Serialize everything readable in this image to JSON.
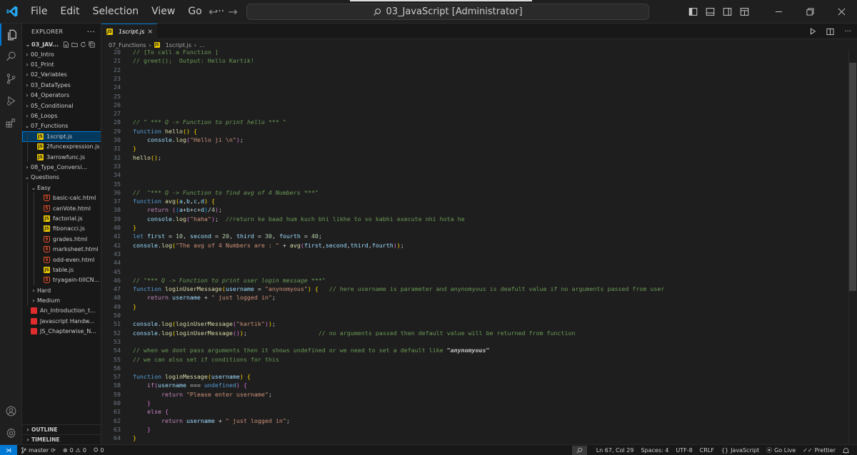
{
  "menu": [
    "File",
    "Edit",
    "Selection",
    "View",
    "Go",
    "···"
  ],
  "search": {
    "title": "03_JavaScript [Administrator]"
  },
  "explorer": {
    "header": "EXPLORER",
    "root": "03_JAV...",
    "items": [
      {
        "label": "00_Intro",
        "kind": "folder",
        "depth": 1,
        "open": false
      },
      {
        "label": "01_Print",
        "kind": "folder",
        "depth": 1,
        "open": false
      },
      {
        "label": "02_Variables",
        "kind": "folder",
        "depth": 1,
        "open": false
      },
      {
        "label": "03_DataTypes",
        "kind": "folder",
        "depth": 1,
        "open": false
      },
      {
        "label": "04_Operators",
        "kind": "folder",
        "depth": 1,
        "open": false
      },
      {
        "label": "05_Conditional",
        "kind": "folder",
        "depth": 1,
        "open": false
      },
      {
        "label": "06_Loops",
        "kind": "folder",
        "depth": 1,
        "open": false
      },
      {
        "label": "07_Functions",
        "kind": "folder",
        "depth": 1,
        "open": true
      },
      {
        "label": "1script.js",
        "kind": "js",
        "depth": 2,
        "selected": true
      },
      {
        "label": "2funcexpression.js",
        "kind": "js",
        "depth": 2
      },
      {
        "label": "3arrowfunc.js",
        "kind": "js",
        "depth": 2
      },
      {
        "label": "08_Type_Conversi...",
        "kind": "folder",
        "depth": 1,
        "open": false
      },
      {
        "label": "Questions",
        "kind": "folder",
        "depth": 1,
        "open": true
      },
      {
        "label": "Easy",
        "kind": "folder",
        "depth": 2,
        "open": true
      },
      {
        "label": "basic-calc.html",
        "kind": "html",
        "depth": 3
      },
      {
        "label": "canVote.html",
        "kind": "html",
        "depth": 3
      },
      {
        "label": "factorial.js",
        "kind": "js",
        "depth": 3
      },
      {
        "label": "fibonacci.js",
        "kind": "js",
        "depth": 3
      },
      {
        "label": "grades.html",
        "kind": "html",
        "depth": 3
      },
      {
        "label": "marksheet.html",
        "kind": "html",
        "depth": 3
      },
      {
        "label": "odd-even.html",
        "kind": "html",
        "depth": 3
      },
      {
        "label": "table.js",
        "kind": "js",
        "depth": 3
      },
      {
        "label": "tryagain-tillCN...",
        "kind": "html",
        "depth": 3
      },
      {
        "label": "Hard",
        "kind": "folder",
        "depth": 2,
        "open": false
      },
      {
        "label": "Medium",
        "kind": "folder",
        "depth": 2,
        "open": false
      },
      {
        "label": "An_Introduction_t...",
        "kind": "pdf",
        "depth": 1
      },
      {
        "label": "Javascript Handw...",
        "kind": "pdf",
        "depth": 1
      },
      {
        "label": "JS_Chapterwise_N...",
        "kind": "pdf",
        "depth": 1
      }
    ],
    "outline": "OUTLINE",
    "timeline": "TIMELINE"
  },
  "tab": {
    "label": "1script.js",
    "close": "×"
  },
  "breadcrumb": {
    "folder": "07_Functions",
    "file": "1script.js",
    "rest": "..."
  },
  "code": [
    {
      "n": "20",
      "t": [
        [
          "cmt",
          "// [To call a Function ]"
        ]
      ]
    },
    {
      "n": "21",
      "t": [
        [
          "cmt",
          "// greet();  Output: Hello Kartik!"
        ]
      ]
    },
    {
      "n": "22",
      "t": []
    },
    {
      "n": "23",
      "t": []
    },
    {
      "n": "24",
      "t": []
    },
    {
      "n": "25",
      "t": []
    },
    {
      "n": "26",
      "t": []
    },
    {
      "n": "27",
      "t": []
    },
    {
      "n": "28",
      "t": [
        [
          "cmti",
          "// \" *** Q -> Function to print hello *** \""
        ]
      ]
    },
    {
      "n": "29",
      "t": [
        [
          "kw",
          "function "
        ],
        [
          "fn",
          "hello"
        ],
        [
          "br1",
          "()"
        ],
        [
          "txt",
          " "
        ],
        [
          "br1",
          "{"
        ]
      ]
    },
    {
      "n": "30",
      "t": [
        [
          "txt",
          "    "
        ],
        [
          "var",
          "console"
        ],
        [
          "txt",
          "."
        ],
        [
          "fn",
          "log"
        ],
        [
          "br2",
          "("
        ],
        [
          "str",
          "\"Hello ji \\n\""
        ],
        [
          "br2",
          ")"
        ],
        [
          "txt",
          ";"
        ]
      ]
    },
    {
      "n": "31",
      "t": [
        [
          "br1",
          "}"
        ]
      ]
    },
    {
      "n": "32",
      "t": [
        [
          "fn",
          "hello"
        ],
        [
          "br1",
          "()"
        ],
        [
          "txt",
          ";"
        ]
      ]
    },
    {
      "n": "33",
      "t": []
    },
    {
      "n": "34",
      "t": []
    },
    {
      "n": "35",
      "t": []
    },
    {
      "n": "36",
      "t": [
        [
          "cmti",
          "//  \"*** Q -> Function to find avg of 4 Numbers ***\""
        ]
      ]
    },
    {
      "n": "37",
      "t": [
        [
          "kw",
          "function "
        ],
        [
          "fn",
          "avg"
        ],
        [
          "br1",
          "("
        ],
        [
          "var",
          "a"
        ],
        [
          "txt",
          ","
        ],
        [
          "var",
          "b"
        ],
        [
          "txt",
          ","
        ],
        [
          "var",
          "c"
        ],
        [
          "txt",
          ","
        ],
        [
          "var",
          "d"
        ],
        [
          "br1",
          ")"
        ],
        [
          "txt",
          " "
        ],
        [
          "br1",
          "{"
        ]
      ]
    },
    {
      "n": "38",
      "t": [
        [
          "txt",
          "    "
        ],
        [
          "ctl",
          "return "
        ],
        [
          "br2",
          "("
        ],
        [
          "br3",
          "("
        ],
        [
          "var",
          "a"
        ],
        [
          "txt",
          "+"
        ],
        [
          "var",
          "b"
        ],
        [
          "txt",
          "+"
        ],
        [
          "var",
          "c"
        ],
        [
          "txt",
          "+"
        ],
        [
          "var",
          "d"
        ],
        [
          "br3",
          ")"
        ],
        [
          "txt",
          "/"
        ],
        [
          "num",
          "4"
        ],
        [
          "br2",
          ")"
        ],
        [
          "txt",
          ";"
        ]
      ]
    },
    {
      "n": "39",
      "t": [
        [
          "txt",
          "    "
        ],
        [
          "var",
          "console"
        ],
        [
          "txt",
          "."
        ],
        [
          "fn",
          "log"
        ],
        [
          "br2",
          "("
        ],
        [
          "str",
          "\"haha\""
        ],
        [
          "br2",
          ")"
        ],
        [
          "txt",
          ";  "
        ],
        [
          "cmt",
          "//return ke baad hum kuch bhi likhe to vo kabhi execute nhi hota he"
        ]
      ]
    },
    {
      "n": "40",
      "t": [
        [
          "br1",
          "}"
        ]
      ]
    },
    {
      "n": "41",
      "t": [
        [
          "kw",
          "let "
        ],
        [
          "var",
          "first"
        ],
        [
          "txt",
          " = "
        ],
        [
          "num",
          "10"
        ],
        [
          "txt",
          ", "
        ],
        [
          "var",
          "second"
        ],
        [
          "txt",
          " = "
        ],
        [
          "num",
          "20"
        ],
        [
          "txt",
          ", "
        ],
        [
          "var",
          "third"
        ],
        [
          "txt",
          " = "
        ],
        [
          "num",
          "30"
        ],
        [
          "txt",
          ", "
        ],
        [
          "var",
          "fourth"
        ],
        [
          "txt",
          " = "
        ],
        [
          "num",
          "40"
        ],
        [
          "txt",
          ";"
        ]
      ]
    },
    {
      "n": "42",
      "t": [
        [
          "var",
          "console"
        ],
        [
          "txt",
          "."
        ],
        [
          "fn",
          "log"
        ],
        [
          "br1",
          "("
        ],
        [
          "str",
          "\"The avg of 4 Numbers are : \""
        ],
        [
          "txt",
          " + "
        ],
        [
          "fn",
          "avg"
        ],
        [
          "br2",
          "("
        ],
        [
          "var",
          "first"
        ],
        [
          "txt",
          ","
        ],
        [
          "var",
          "second"
        ],
        [
          "txt",
          ","
        ],
        [
          "var",
          "third"
        ],
        [
          "txt",
          ","
        ],
        [
          "var",
          "fourth"
        ],
        [
          "br2",
          ")"
        ],
        [
          "br1",
          ")"
        ],
        [
          "txt",
          ";"
        ]
      ]
    },
    {
      "n": "43",
      "t": []
    },
    {
      "n": "44",
      "t": []
    },
    {
      "n": "45",
      "t": []
    },
    {
      "n": "46",
      "t": [
        [
          "cmti",
          "// \"*** Q -> Function to print user login message ***\""
        ]
      ]
    },
    {
      "n": "47",
      "t": [
        [
          "kw",
          "function "
        ],
        [
          "fn",
          "loginUserMessage"
        ],
        [
          "br1",
          "("
        ],
        [
          "var",
          "username"
        ],
        [
          "txt",
          " = "
        ],
        [
          "str",
          "\"anynomyous\""
        ],
        [
          "br1",
          ")"
        ],
        [
          "txt",
          " "
        ],
        [
          "br1",
          "{"
        ],
        [
          "txt",
          "   "
        ],
        [
          "cmt",
          "// here username is parameter and anynomyous is deafult value if no arguments passed from user"
        ]
      ]
    },
    {
      "n": "48",
      "t": [
        [
          "txt",
          "    "
        ],
        [
          "ctl",
          "return "
        ],
        [
          "var",
          "username"
        ],
        [
          "txt",
          " + "
        ],
        [
          "str",
          "\" just logged in\""
        ],
        [
          "txt",
          ";"
        ]
      ]
    },
    {
      "n": "49",
      "t": [
        [
          "br1",
          "}"
        ]
      ]
    },
    {
      "n": "50",
      "t": []
    },
    {
      "n": "51",
      "t": [
        [
          "var",
          "console"
        ],
        [
          "txt",
          "."
        ],
        [
          "fn",
          "log"
        ],
        [
          "br1",
          "("
        ],
        [
          "fn",
          "loginUserMessage"
        ],
        [
          "br2",
          "("
        ],
        [
          "str",
          "\"kartik\""
        ],
        [
          "br2",
          ")"
        ],
        [
          "br1",
          ")"
        ],
        [
          "txt",
          ";"
        ]
      ]
    },
    {
      "n": "52",
      "t": [
        [
          "var",
          "console"
        ],
        [
          "txt",
          "."
        ],
        [
          "fn",
          "log"
        ],
        [
          "br1",
          "("
        ],
        [
          "fn",
          "loginUserMessage"
        ],
        [
          "br2",
          "()"
        ],
        [
          "br1",
          ")"
        ],
        [
          "txt",
          ";                    "
        ],
        [
          "cmt",
          "// no arguments passed then default value will be returned from function"
        ]
      ]
    },
    {
      "n": "53",
      "t": []
    },
    {
      "n": "54",
      "t": [
        [
          "cmt",
          "// when we dont pass arguments then it shows undefined or we need to set a default like "
        ],
        [
          "cmtb",
          "\"anynomyous\""
        ]
      ]
    },
    {
      "n": "55",
      "t": [
        [
          "cmt",
          "// we can also set if conditions for this"
        ]
      ]
    },
    {
      "n": "56",
      "t": []
    },
    {
      "n": "57",
      "t": [
        [
          "kw",
          "function "
        ],
        [
          "fn",
          "loginMessage"
        ],
        [
          "br1",
          "("
        ],
        [
          "var",
          "username"
        ],
        [
          "br1",
          ")"
        ],
        [
          "txt",
          " "
        ],
        [
          "br1",
          "{"
        ]
      ]
    },
    {
      "n": "58",
      "t": [
        [
          "txt",
          "    "
        ],
        [
          "ctl",
          "if"
        ],
        [
          "br2",
          "("
        ],
        [
          "var",
          "username"
        ],
        [
          "txt",
          " === "
        ],
        [
          "kw",
          "undefined"
        ],
        [
          "br2",
          ")"
        ],
        [
          "txt",
          " "
        ],
        [
          "br2",
          "{"
        ]
      ]
    },
    {
      "n": "59",
      "t": [
        [
          "txt",
          "        "
        ],
        [
          "ctl",
          "return "
        ],
        [
          "str",
          "\"Please enter username\""
        ],
        [
          "txt",
          ";"
        ]
      ]
    },
    {
      "n": "60",
      "t": [
        [
          "txt",
          "    "
        ],
        [
          "br2",
          "}"
        ]
      ]
    },
    {
      "n": "61",
      "t": [
        [
          "txt",
          "    "
        ],
        [
          "ctl",
          "else "
        ],
        [
          "br2",
          "{"
        ]
      ]
    },
    {
      "n": "62",
      "t": [
        [
          "txt",
          "        "
        ],
        [
          "ctl",
          "return "
        ],
        [
          "var",
          "username"
        ],
        [
          "txt",
          " + "
        ],
        [
          "str",
          "\" just logged in\""
        ],
        [
          "txt",
          ";"
        ]
      ]
    },
    {
      "n": "63",
      "t": [
        [
          "txt",
          "    "
        ],
        [
          "br2",
          "}"
        ]
      ]
    },
    {
      "n": "64",
      "t": [
        [
          "br1",
          "}"
        ]
      ]
    }
  ],
  "status": {
    "branch": "master",
    "errors": "0",
    "warnings": "0",
    "ports": "0",
    "position": "Ln 67, Col 29",
    "spaces": "Spaces: 4",
    "encoding": "UTF-8",
    "eol": "CRLF",
    "language": "JavaScript",
    "golive": "Go Live",
    "prettier": "Prettier"
  },
  "colors": {
    "accent": "#0078d4",
    "editor_bg": "#1e1e1e",
    "sidebar_bg": "#181818"
  }
}
